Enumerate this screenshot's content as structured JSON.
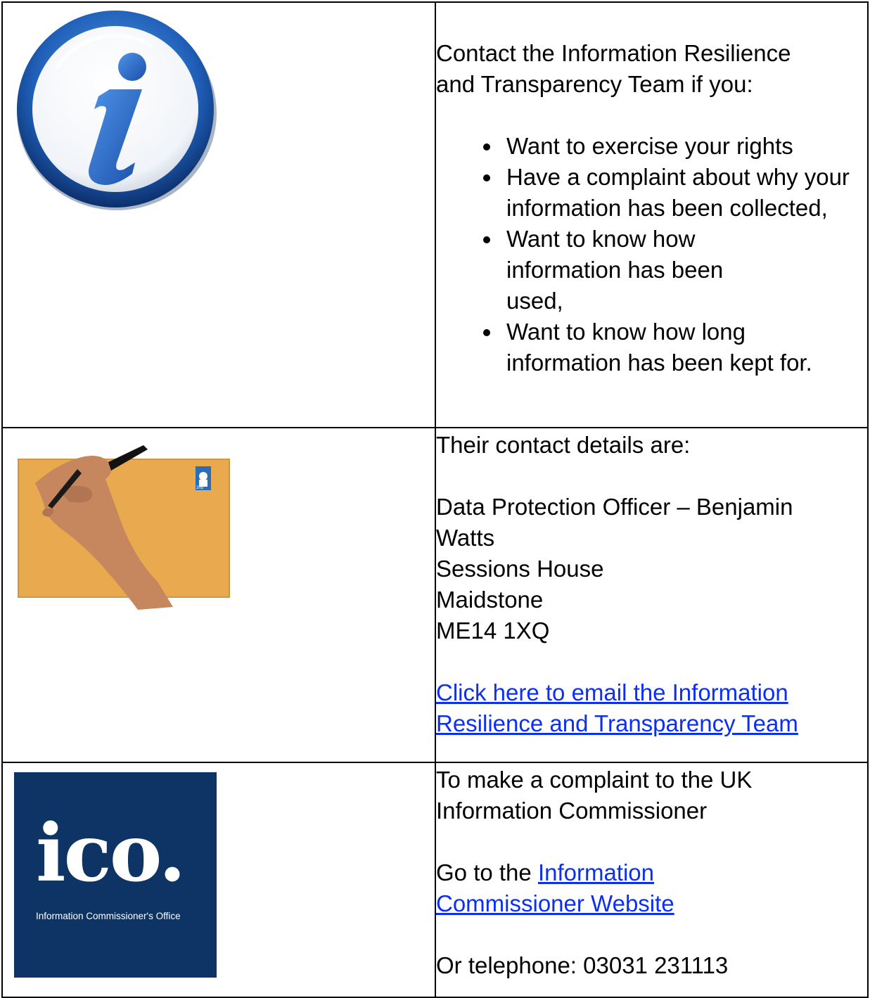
{
  "row1": {
    "icon": "info-icon",
    "intro": "Contact the Information Resilience and Transparency Team if you:",
    "bullets": [
      "Want to exercise your rights",
      "Have a complaint about why your information has been collected,",
      "Want to know how information has been used,",
      "Want to know how long information has been kept for."
    ]
  },
  "row2": {
    "image": "envelope-writing-hand-image",
    "heading": "Their contact details are:",
    "address": [
      "Data Protection Officer – Benjamin Watts",
      "Sessions House",
      "Maidstone",
      "ME14 1XQ"
    ],
    "email_link": "Click here to email the Information Resilience and Transparency Team",
    "stamp_text": "2nd"
  },
  "row3": {
    "logo": {
      "wordmark": "ico.",
      "subtitle": "Information Commissioner's Office",
      "background": "#0d3465"
    },
    "line1": "To make a complaint to the UK Information Commissioner",
    "go_prefix": "Go to the ",
    "website_link": "Information Commissioner Website",
    "telephone": "Or telephone: 03031 231113"
  },
  "colors": {
    "link": "#0b2ff5",
    "border": "#000000",
    "info_blue": "#1f5fb8"
  }
}
